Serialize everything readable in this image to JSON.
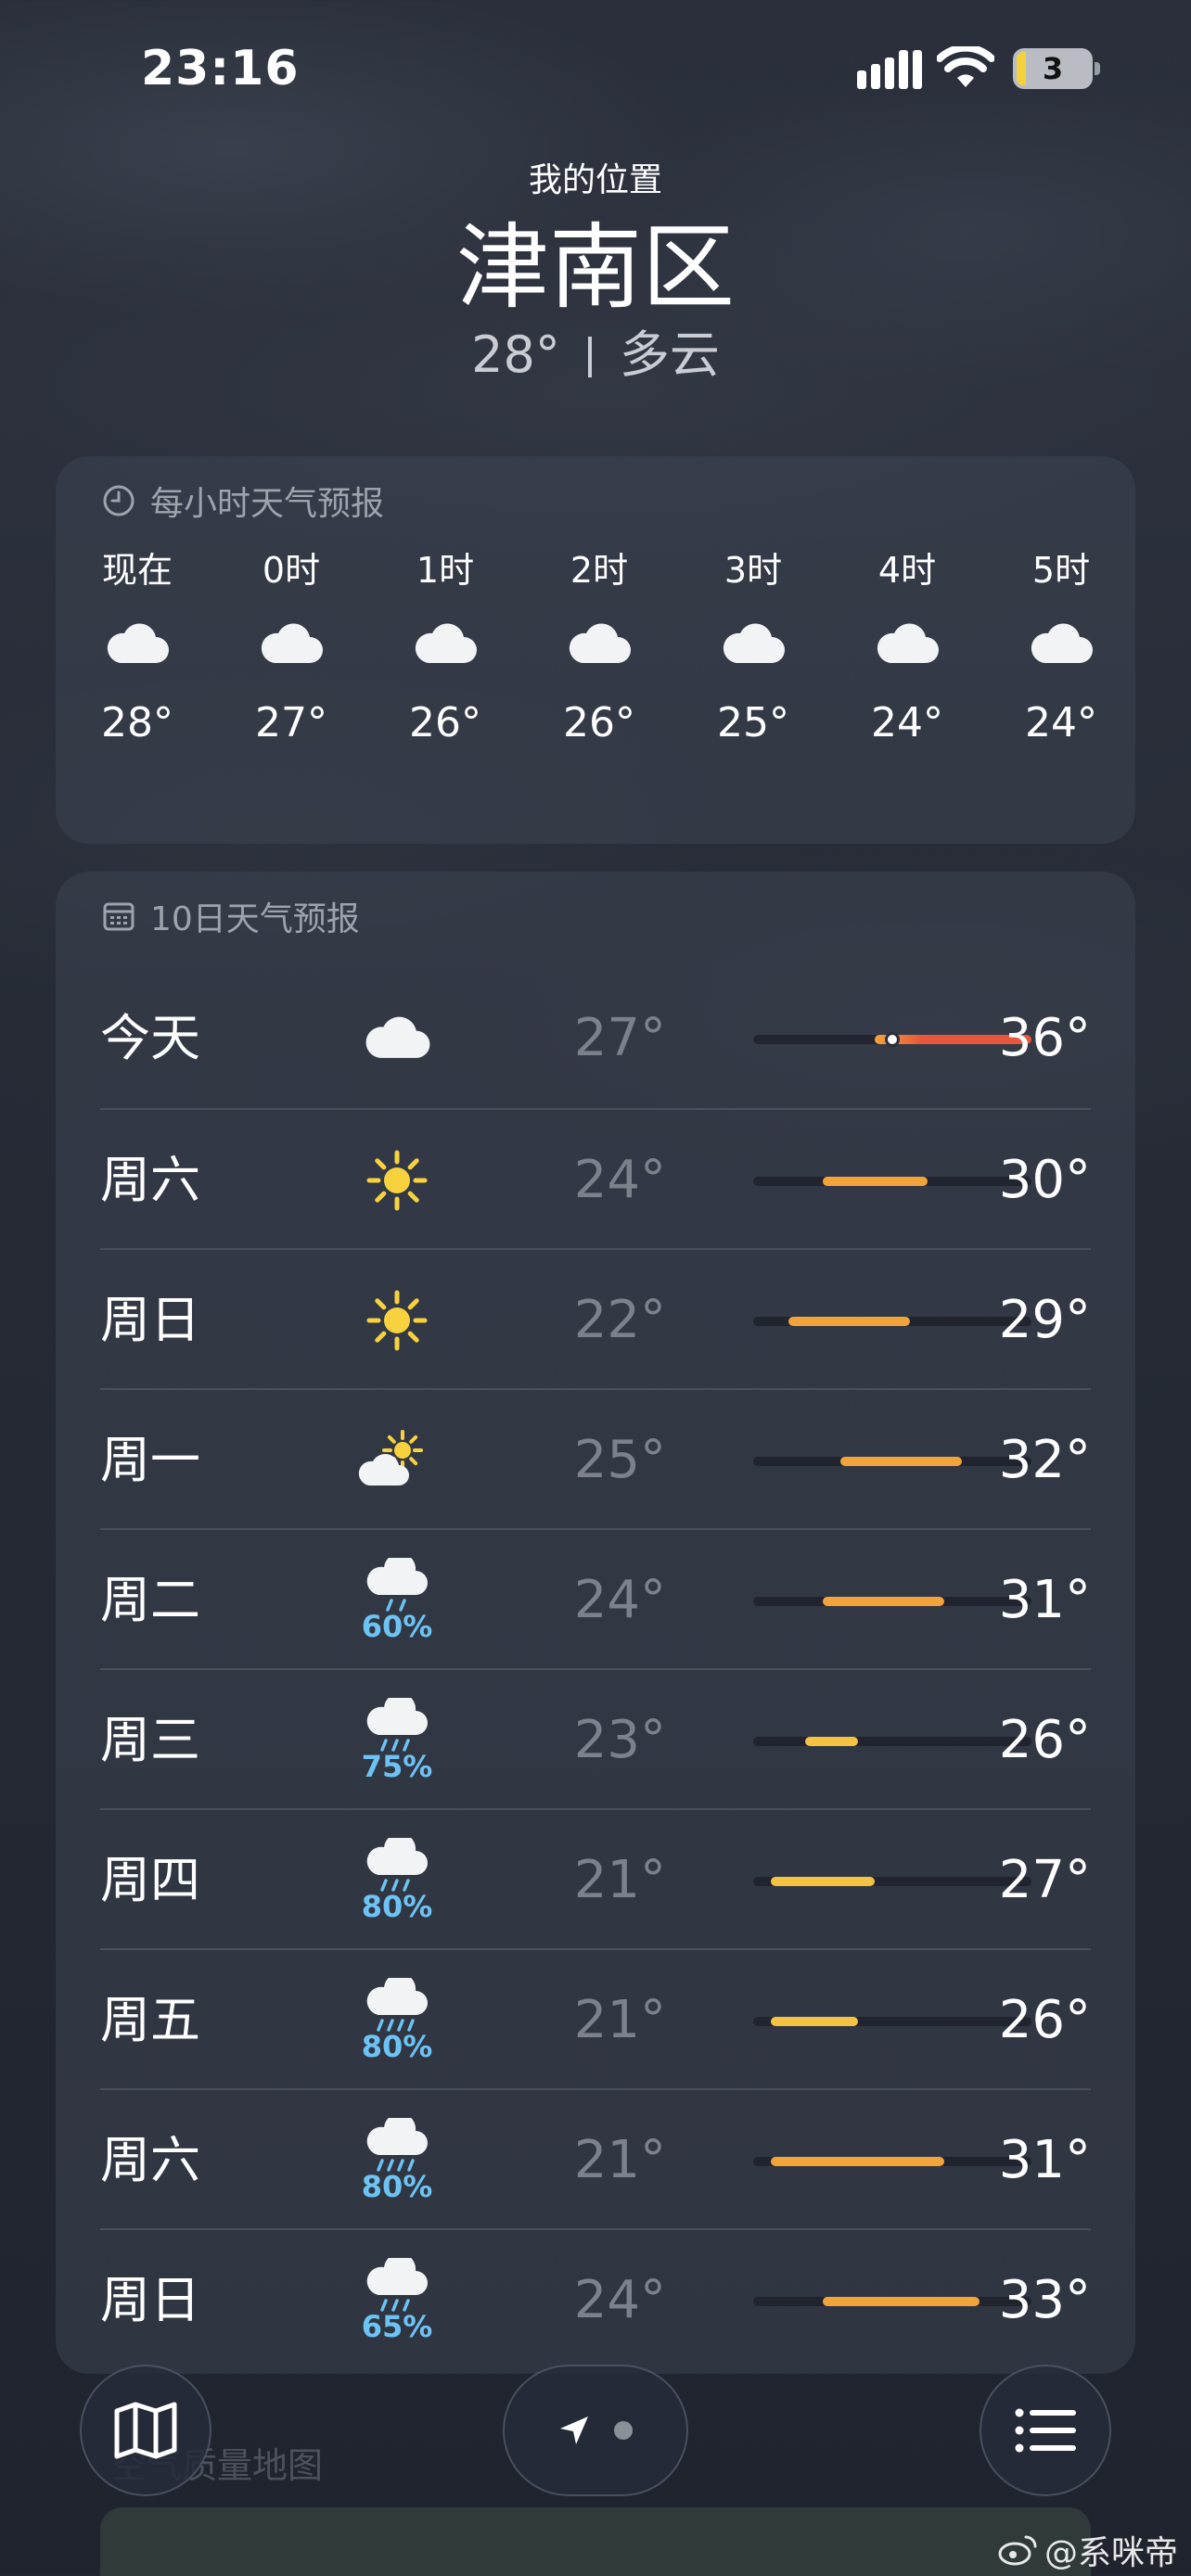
{
  "status_bar": {
    "time": "23:16",
    "battery": "3"
  },
  "header": {
    "my_location": "我的位置",
    "city": "津南区",
    "temperature": "28°",
    "condition": "多云"
  },
  "hourly": {
    "title": "每小时天气预报",
    "hours": [
      {
        "label": "现在",
        "temp": "28°",
        "icon": "cloud-icon"
      },
      {
        "label": "0时",
        "temp": "27°",
        "icon": "cloud-icon"
      },
      {
        "label": "1时",
        "temp": "26°",
        "icon": "cloud-icon"
      },
      {
        "label": "2时",
        "temp": "26°",
        "icon": "cloud-icon"
      },
      {
        "label": "3时",
        "temp": "25°",
        "icon": "cloud-icon"
      },
      {
        "label": "4时",
        "temp": "24°",
        "icon": "cloud-icon"
      },
      {
        "label": "5时",
        "temp": "24°",
        "icon": "cloud-icon"
      }
    ]
  },
  "daily": {
    "title": "10日天气预报",
    "days": [
      {
        "name": "今天",
        "icon": "cloud",
        "precip": "",
        "low": "27°",
        "high": "36°",
        "low_value": 27,
        "high_value": 36,
        "current_value": 28
      },
      {
        "name": "周六",
        "icon": "sun",
        "precip": "",
        "low": "24°",
        "high": "30°",
        "low_value": 24,
        "high_value": 30
      },
      {
        "name": "周日",
        "icon": "sun",
        "precip": "",
        "low": "22°",
        "high": "29°",
        "low_value": 22,
        "high_value": 29
      },
      {
        "name": "周一",
        "icon": "partly-cloudy",
        "precip": "",
        "low": "25°",
        "high": "32°",
        "low_value": 25,
        "high_value": 32
      },
      {
        "name": "周二",
        "icon": "light-rain",
        "precip": "60%",
        "low": "24°",
        "high": "31°",
        "low_value": 24,
        "high_value": 31
      },
      {
        "name": "周三",
        "icon": "rain",
        "precip": "75%",
        "low": "23°",
        "high": "26°",
        "low_value": 23,
        "high_value": 26
      },
      {
        "name": "周四",
        "icon": "rain",
        "precip": "80%",
        "low": "21°",
        "high": "27°",
        "low_value": 21,
        "high_value": 27
      },
      {
        "name": "周五",
        "icon": "heavy-rain",
        "precip": "80%",
        "low": "21°",
        "high": "26°",
        "low_value": 21,
        "high_value": 26
      },
      {
        "name": "周六",
        "icon": "heavy-rain",
        "precip": "80%",
        "low": "21°",
        "high": "31°",
        "low_value": 21,
        "high_value": 31
      },
      {
        "name": "周日",
        "icon": "rain",
        "precip": "65%",
        "low": "24°",
        "high": "33°",
        "low_value": 24,
        "high_value": 33
      }
    ],
    "range_min": 20,
    "range_max": 36
  },
  "bottom": {
    "air_quality_label": "空气质量地图"
  },
  "watermark": "@系咪帝",
  "colors": {
    "precip": "#6cc3f4",
    "bar_warm": "#f2a43a",
    "bar_hot": "#e8573c",
    "bar_mild": "#f5c342",
    "sun": "#f7d23e"
  }
}
